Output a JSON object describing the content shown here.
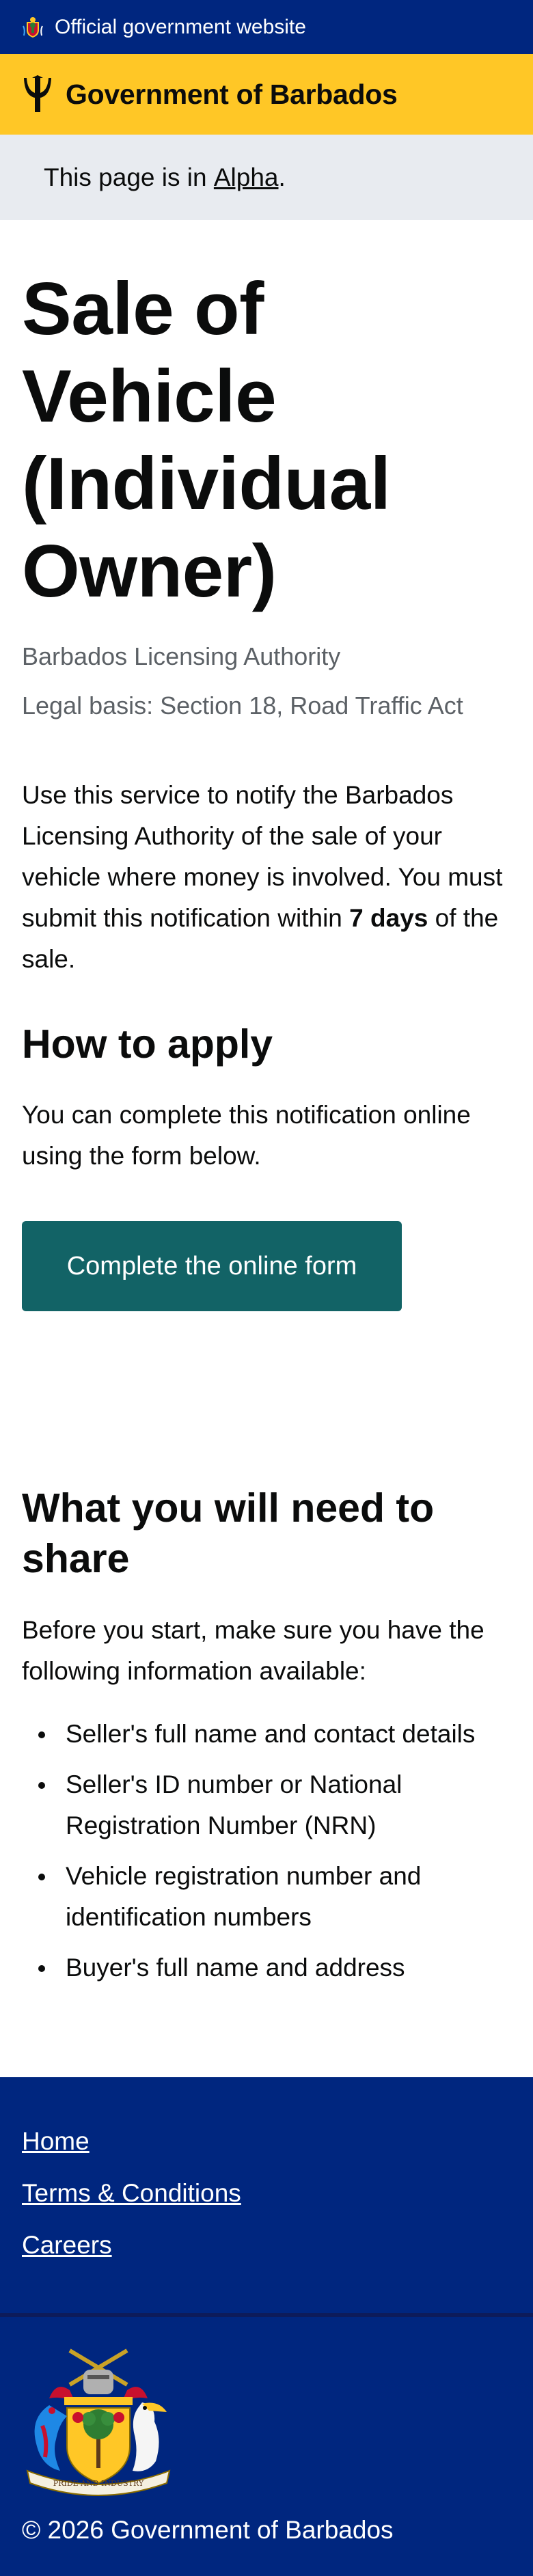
{
  "topbar": {
    "text": "Official government website",
    "icon": "barbados-crest-icon"
  },
  "brand": {
    "name": "Government of Barbados",
    "icon": "trident-icon"
  },
  "phase": {
    "prefix": "This page is in ",
    "link": "Alpha",
    "suffix": "."
  },
  "page": {
    "title": "Sale of Vehicle (Individual Owner)",
    "organisation": "Barbados Licensing Authority",
    "legal_basis": "Legal basis: Section 18, Road Traffic Act",
    "intro_start": "Use this service to notify the Barbados Licensing Authority of the sale of your vehicle where money is involved. You must submit this notification within ",
    "intro_bold": "7 days",
    "intro_end": " of the sale."
  },
  "how_to_apply": {
    "heading": "How to apply",
    "text": "You can complete this notification online using the form below.",
    "button": "Complete the online form"
  },
  "what_you_need": {
    "heading": "What you will need to share",
    "text": "Before you start, make sure you have the following information available:",
    "items": [
      "Seller's full name and contact details",
      "Seller's ID number or National Registration Number (NRN)",
      "Vehicle registration number and identification numbers",
      "Buyer's full name and address"
    ]
  },
  "footer": {
    "links": [
      "Home",
      "Terms & Conditions",
      "Careers"
    ],
    "coat_of_arms_motto": "PRIDE AND INDUSTRY",
    "copyright": "© 2026 Government of Barbados"
  },
  "colors": {
    "navy": "#00267f",
    "gold": "#ffc726",
    "phase_bg": "#e8ebf0",
    "button": "#126366",
    "text": "#0b0c0c",
    "muted": "#5c6166"
  }
}
